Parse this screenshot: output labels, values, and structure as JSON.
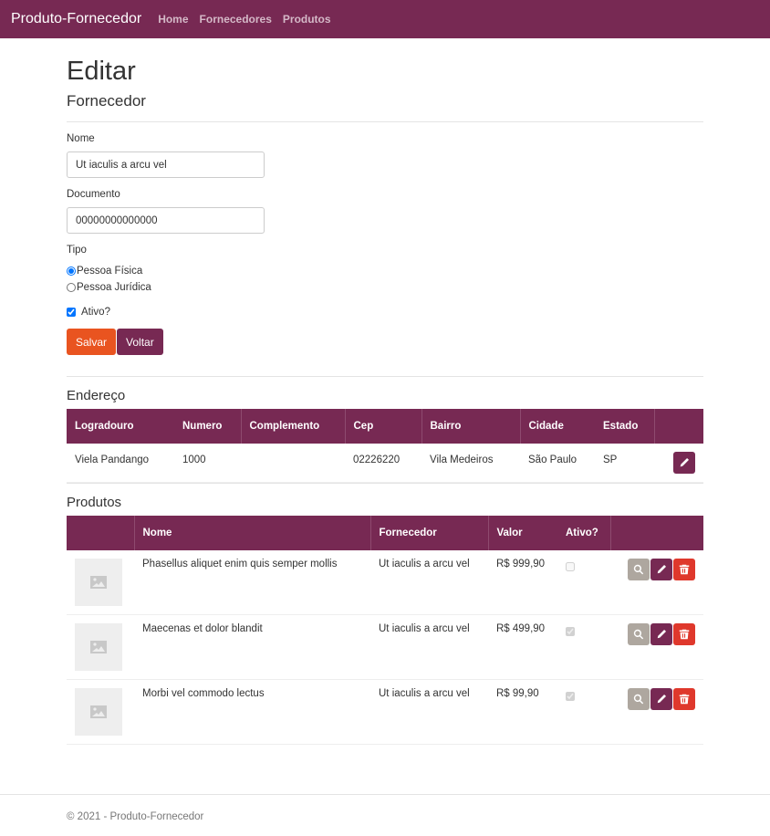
{
  "nav": {
    "brand": "Produto-Fornecedor",
    "links": [
      "Home",
      "Fornecedores",
      "Produtos"
    ]
  },
  "page": {
    "title": "Editar",
    "subtitle": "Fornecedor"
  },
  "form": {
    "nome_label": "Nome",
    "nome_value": "Ut iaculis a arcu vel",
    "documento_label": "Documento",
    "documento_value": "00000000000000",
    "tipo_label": "Tipo",
    "tipo_options": [
      "Pessoa Física",
      "Pessoa Jurídica"
    ],
    "tipo_selected": "Pessoa Física",
    "ativo_label": "Ativo?",
    "ativo_checked": true,
    "save_label": "Salvar",
    "back_label": "Voltar"
  },
  "endereco": {
    "heading": "Endereço",
    "columns": [
      "Logradouro",
      "Numero",
      "Complemento",
      "Cep",
      "Bairro",
      "Cidade",
      "Estado"
    ],
    "row": {
      "logradouro": "Viela Pandango",
      "numero": "1000",
      "complemento": "",
      "cep": "02226220",
      "bairro": "Vila Medeiros",
      "cidade": "São Paulo",
      "estado": "SP"
    }
  },
  "produtos": {
    "heading": "Produtos",
    "columns": [
      "Nome",
      "Fornecedor",
      "Valor",
      "Ativo?"
    ],
    "rows": [
      {
        "nome": "Phasellus aliquet enim quis semper mollis",
        "fornecedor": "Ut iaculis a arcu vel",
        "valor": "R$ 999,90",
        "ativo": false
      },
      {
        "nome": "Maecenas et dolor blandit",
        "fornecedor": "Ut iaculis a arcu vel",
        "valor": "R$ 499,90",
        "ativo": true
      },
      {
        "nome": "Morbi vel commodo lectus",
        "fornecedor": "Ut iaculis a arcu vel",
        "valor": "R$ 99,90",
        "ativo": true
      }
    ]
  },
  "footer": {
    "text": "© 2021 - Produto-Fornecedor"
  },
  "colors": {
    "primary": "#772953",
    "accent": "#e95420",
    "danger": "#df382c",
    "muted": "#aea79f"
  },
  "icons": {
    "view": "search-icon",
    "edit": "pencil-icon",
    "delete": "trash-icon",
    "thumb": "image-placeholder-icon"
  }
}
